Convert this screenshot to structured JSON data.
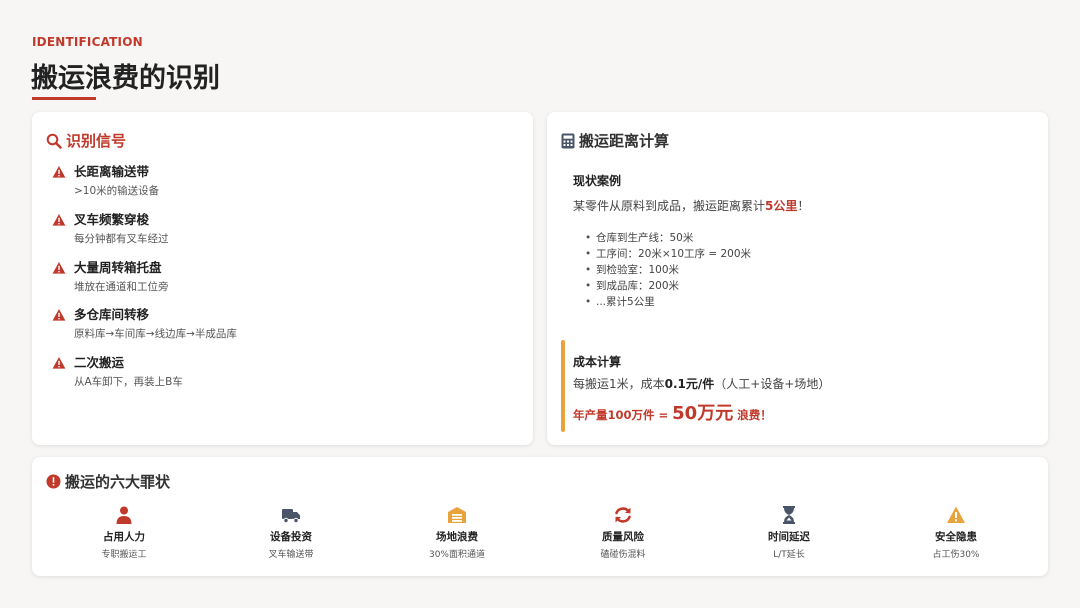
{
  "header": {
    "eyebrow": "IDENTIFICATION",
    "title": "搬运浪费的识别",
    "accent_color": "#c0392b"
  },
  "signals": {
    "title": "识别信号",
    "icon": "magnifier-icon",
    "items": [
      {
        "title": "长距离输送带",
        "desc": ">10米的输送设备"
      },
      {
        "title": "叉车频繁穿梭",
        "desc": "每分钟都有叉车经过"
      },
      {
        "title": "大量周转箱托盘",
        "desc": "堆放在通道和工位旁"
      },
      {
        "title": "多仓库间转移",
        "desc": "原料库→车间库→线边库→半成品库"
      },
      {
        "title": "二次搬运",
        "desc": "从A车卸下，再装上B车"
      }
    ]
  },
  "distance": {
    "title": "搬运距离计算",
    "icon": "calculator-icon",
    "case_title": "现状案例",
    "case_desc_prefix": "某零件从原料到成品，搬运距离累计",
    "case_desc_highlight": "5公里",
    "case_desc_suffix": "！",
    "case_list": [
      "仓库到生产线：50米",
      "工序间：20米×10工序 = 200米",
      "到检验室：100米",
      "到成品库：200米",
      "...累计5公里"
    ],
    "cost_title": "成本计算",
    "cost_desc_prefix": "每搬运1米，成本",
    "cost_desc_bold": "0.1元/件",
    "cost_desc_suffix": "（人工+设备+场地）",
    "result_prefix": "年产量100万件 =",
    "result_big": "50万元",
    "result_suffix": "浪费！",
    "bar_color": "#e8a33d"
  },
  "sins": {
    "title": "搬运的六大罪状",
    "icon": "exclamation-circle-icon",
    "items": [
      {
        "name": "占用人力",
        "sub": "专职搬运工",
        "icon": "person-icon",
        "color": "#c0392b"
      },
      {
        "name": "设备投资",
        "sub": "叉车输送带",
        "icon": "truck-icon",
        "color": "#4a5568"
      },
      {
        "name": "场地浪费",
        "sub": "30%面积通道",
        "icon": "warehouse-icon",
        "color": "#e8a33d"
      },
      {
        "name": "质量风险",
        "sub": "磕碰伤混料",
        "icon": "refresh-icon",
        "color": "#c0392b"
      },
      {
        "name": "时间延迟",
        "sub": "L/T延长",
        "icon": "hourglass-icon",
        "color": "#4a5568"
      },
      {
        "name": "安全隐患",
        "sub": "占工伤30%",
        "icon": "warning-icon",
        "color": "#e8a33d"
      }
    ]
  }
}
